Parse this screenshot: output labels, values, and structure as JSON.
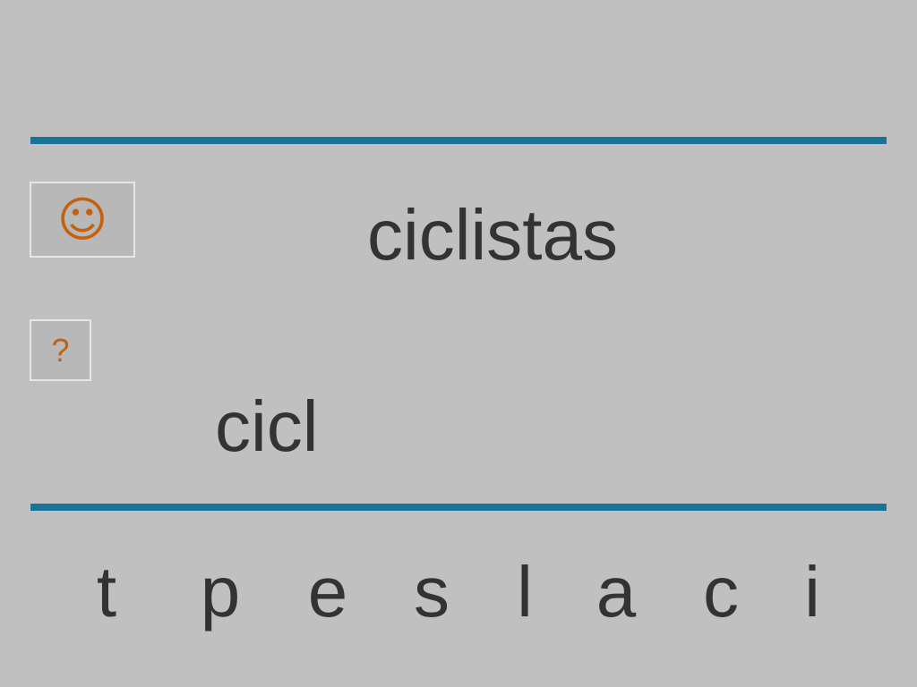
{
  "buttons": {
    "smiley_icon": "☺",
    "help_label": "?"
  },
  "target_word": "ciclistas",
  "typed_word": "cicl",
  "letters": [
    "t",
    "p",
    "e",
    "s",
    "l",
    "a",
    "c",
    "i"
  ],
  "colors": {
    "background": "#c0c0c0",
    "rule": "#1a7499",
    "icon_accent": "#c4610f",
    "text": "#333333"
  }
}
